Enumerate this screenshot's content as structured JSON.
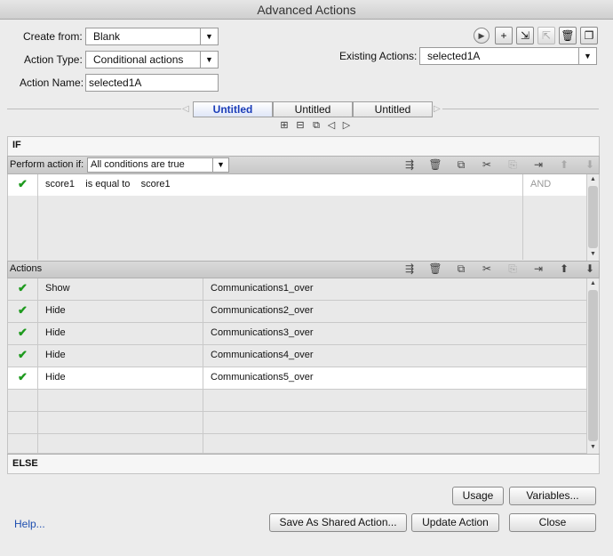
{
  "window": {
    "title": "Advanced Actions"
  },
  "form": {
    "create_from_label": "Create from:",
    "create_from_value": "Blank",
    "action_type_label": "Action Type:",
    "action_type_value": "Conditional actions",
    "action_name_label": "Action Name:",
    "action_name_value": "selected1A",
    "existing_actions_label": "Existing Actions:",
    "existing_actions_value": "selected1A"
  },
  "toolbar": {
    "icons": [
      "preview-icon",
      "add-icon",
      "import-icon",
      "export-icon",
      "delete-icon",
      "duplicate-icon"
    ]
  },
  "tabs": [
    {
      "label": "Untitled",
      "active": true
    },
    {
      "label": "Untitled",
      "active": false
    },
    {
      "label": "Untitled",
      "active": false
    }
  ],
  "if_section": {
    "label": "IF",
    "perform_label": "Perform action if:",
    "perform_value": "All conditions are true",
    "conditions": [
      {
        "operand1": "score1",
        "operator": "is equal to",
        "operand2": "score1",
        "conjunction": "AND"
      }
    ],
    "empty_rows": 3
  },
  "actions_section": {
    "label": "Actions",
    "rows": [
      {
        "action": "Show",
        "target": "Communications1_over"
      },
      {
        "action": "Hide",
        "target": "Communications2_over"
      },
      {
        "action": "Hide",
        "target": "Communications3_over"
      },
      {
        "action": "Hide",
        "target": "Communications4_over"
      },
      {
        "action": "Hide",
        "target": "Communications5_over"
      }
    ],
    "empty_rows": 3
  },
  "else_section": {
    "label": "ELSE"
  },
  "buttons": {
    "usage": "Usage",
    "variables": "Variables...",
    "save_shared": "Save As Shared Action...",
    "update": "Update Action",
    "close": "Close",
    "help": "Help..."
  }
}
